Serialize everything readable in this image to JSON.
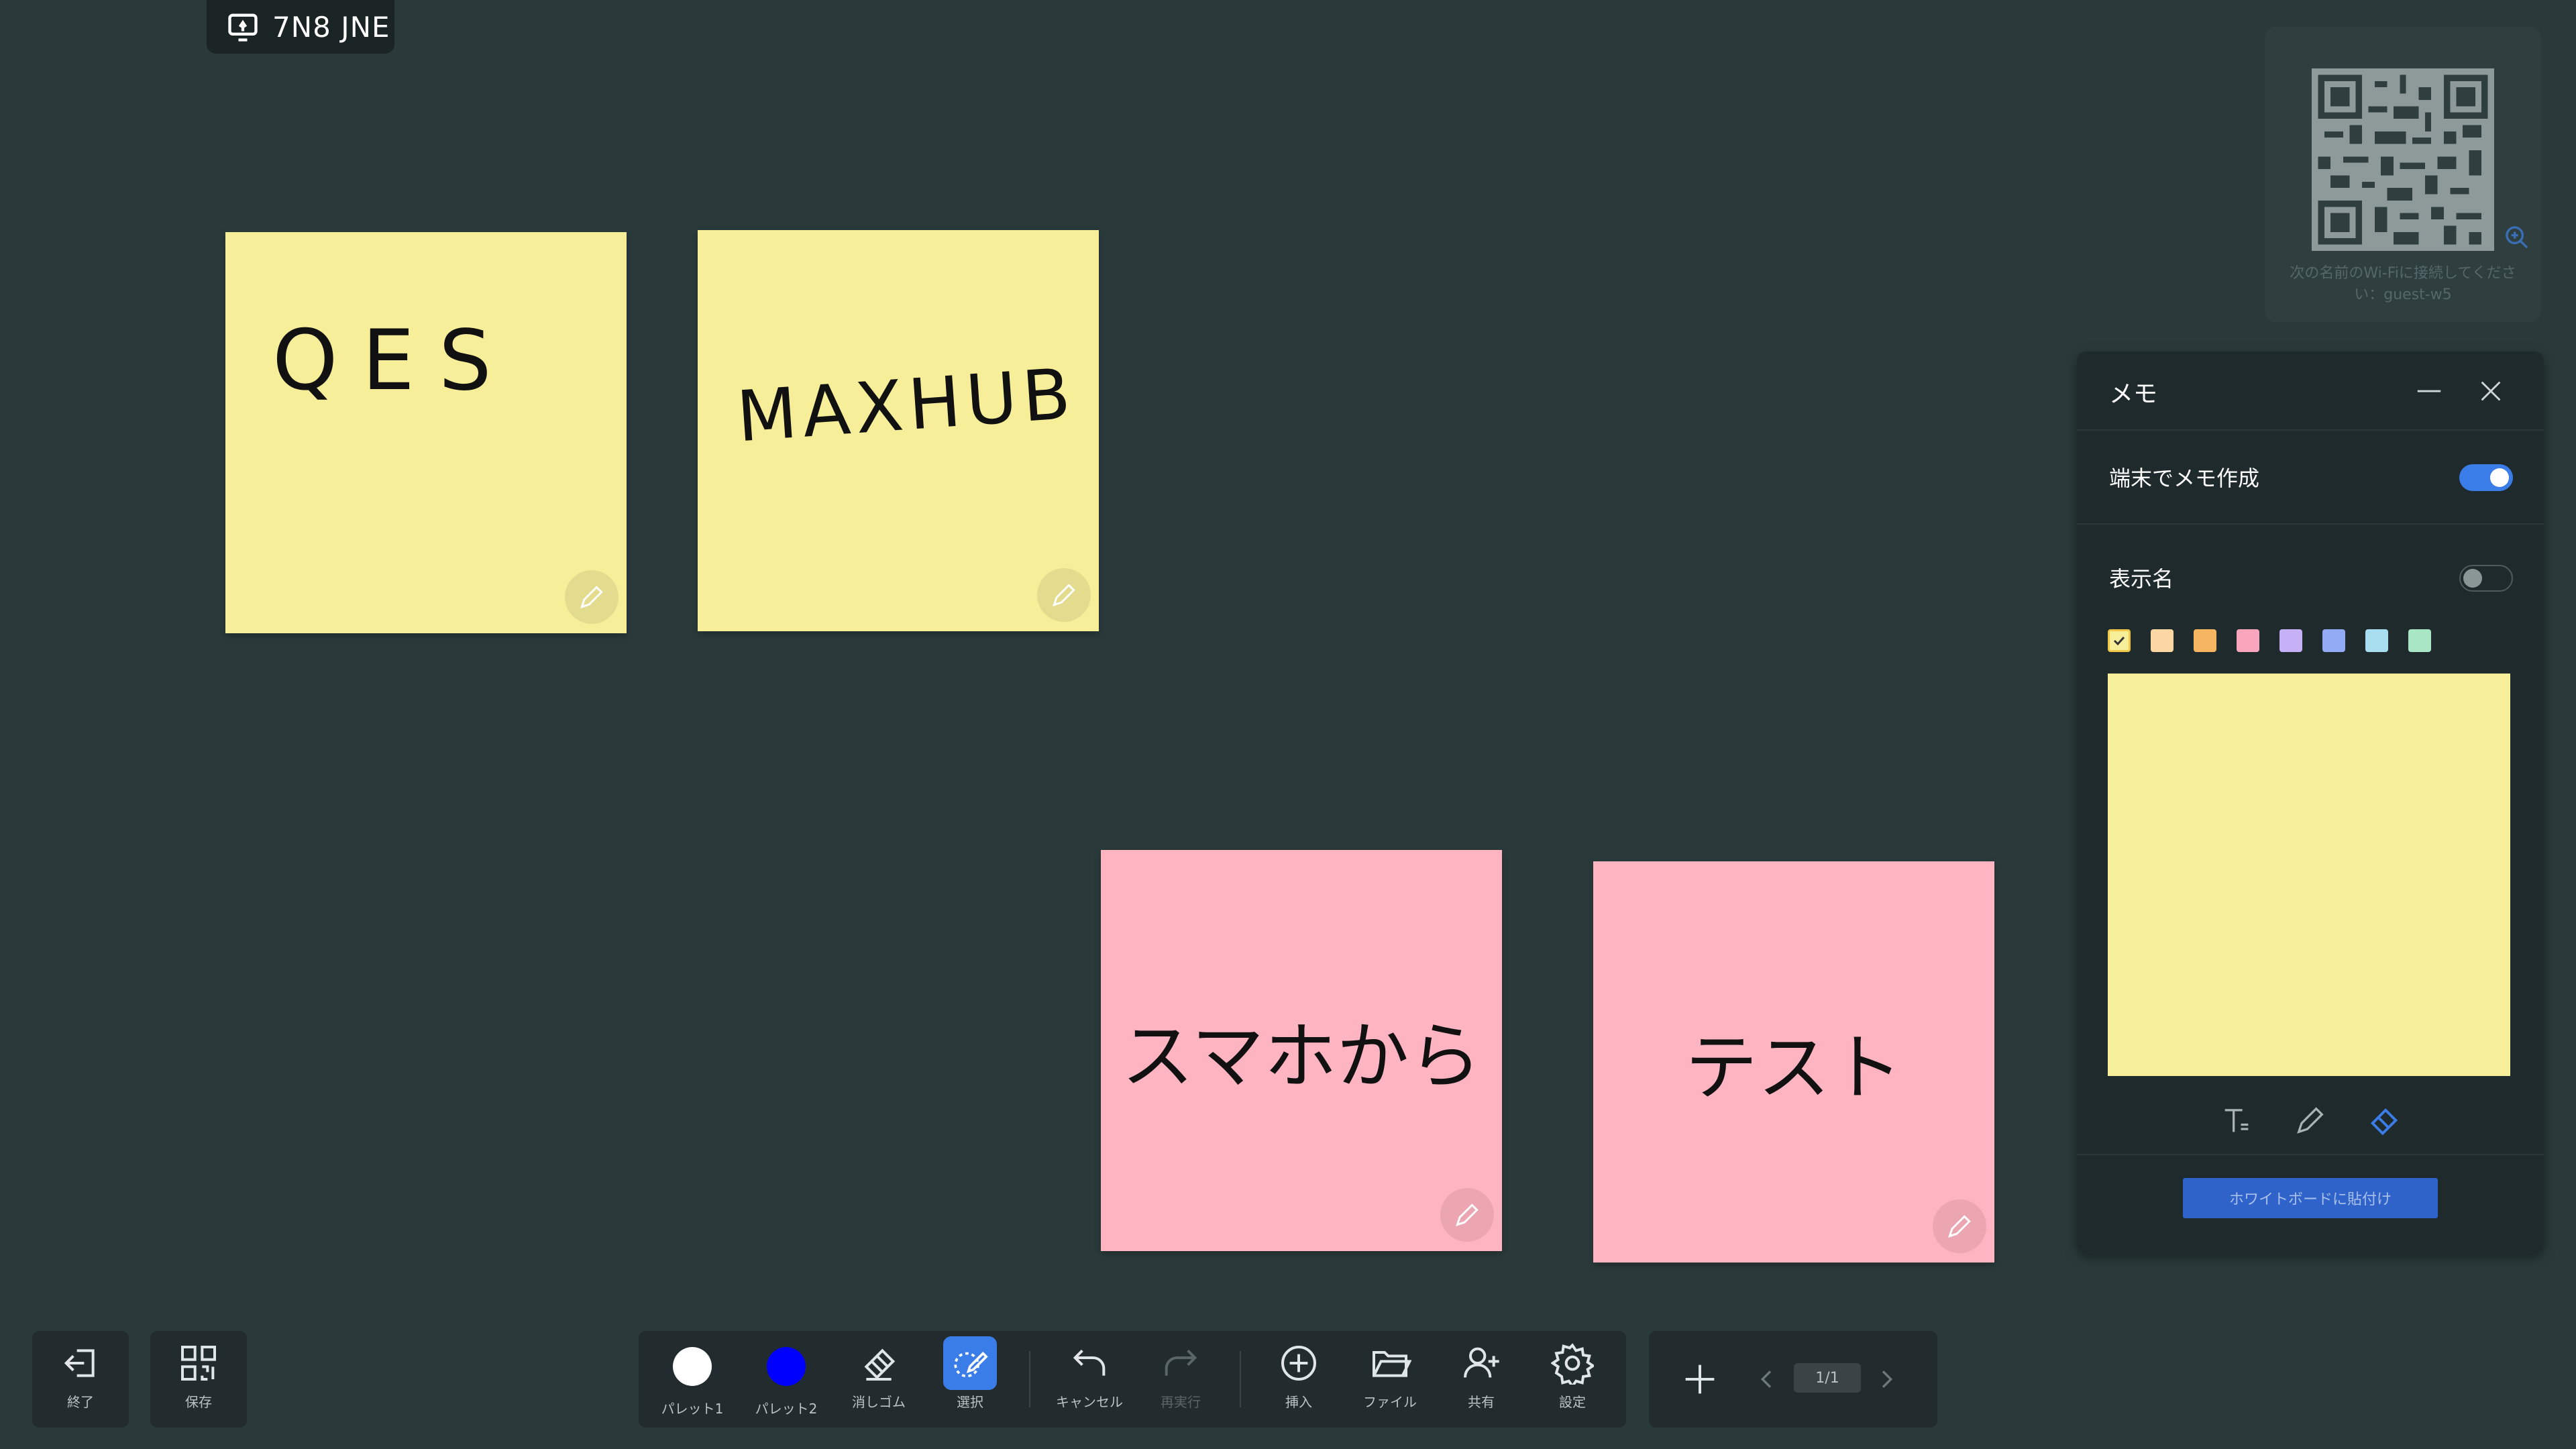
{
  "share": {
    "code": "7N8 JNE",
    "icon": "screen-share-icon"
  },
  "notes": [
    {
      "text": "QES",
      "color": "#f7ee9a",
      "style": "handwritten"
    },
    {
      "text": "MAXHUB",
      "color": "#f7ee9a",
      "style": "handwritten"
    },
    {
      "text": "スマホから",
      "color": "#ffb5c1",
      "style": "typed"
    },
    {
      "text": "テスト",
      "color": "#ffb5c1",
      "style": "typed"
    }
  ],
  "qr_panel": {
    "hint": "次の名前のWi-Fiに接続してください：guest-w5"
  },
  "memo": {
    "title": "メモ",
    "device_memo_label": "端末でメモ作成",
    "device_memo_on": true,
    "display_name_label": "表示名",
    "display_name_on": false,
    "colors": [
      "#f7ee9a",
      "#fcd7a4",
      "#f6b561",
      "#f9a6bd",
      "#c6b1f7",
      "#93aaf5",
      "#a8ddf0",
      "#a8e6c5"
    ],
    "selected_color": "#f7ee9a",
    "paste_button": "ホワイトボードに貼付け"
  },
  "toolbar": {
    "exit": "終了",
    "save": "保存",
    "palette1": "パレット1",
    "palette1_color": "#ffffff",
    "palette2": "パレット2",
    "palette2_color": "#0000ff",
    "eraser": "消しゴム",
    "select": "選択",
    "undo": "キャンセル",
    "redo": "再実行",
    "insert": "挿入",
    "file": "ファイル",
    "share": "共有",
    "settings": "設定",
    "page": "1/1"
  }
}
